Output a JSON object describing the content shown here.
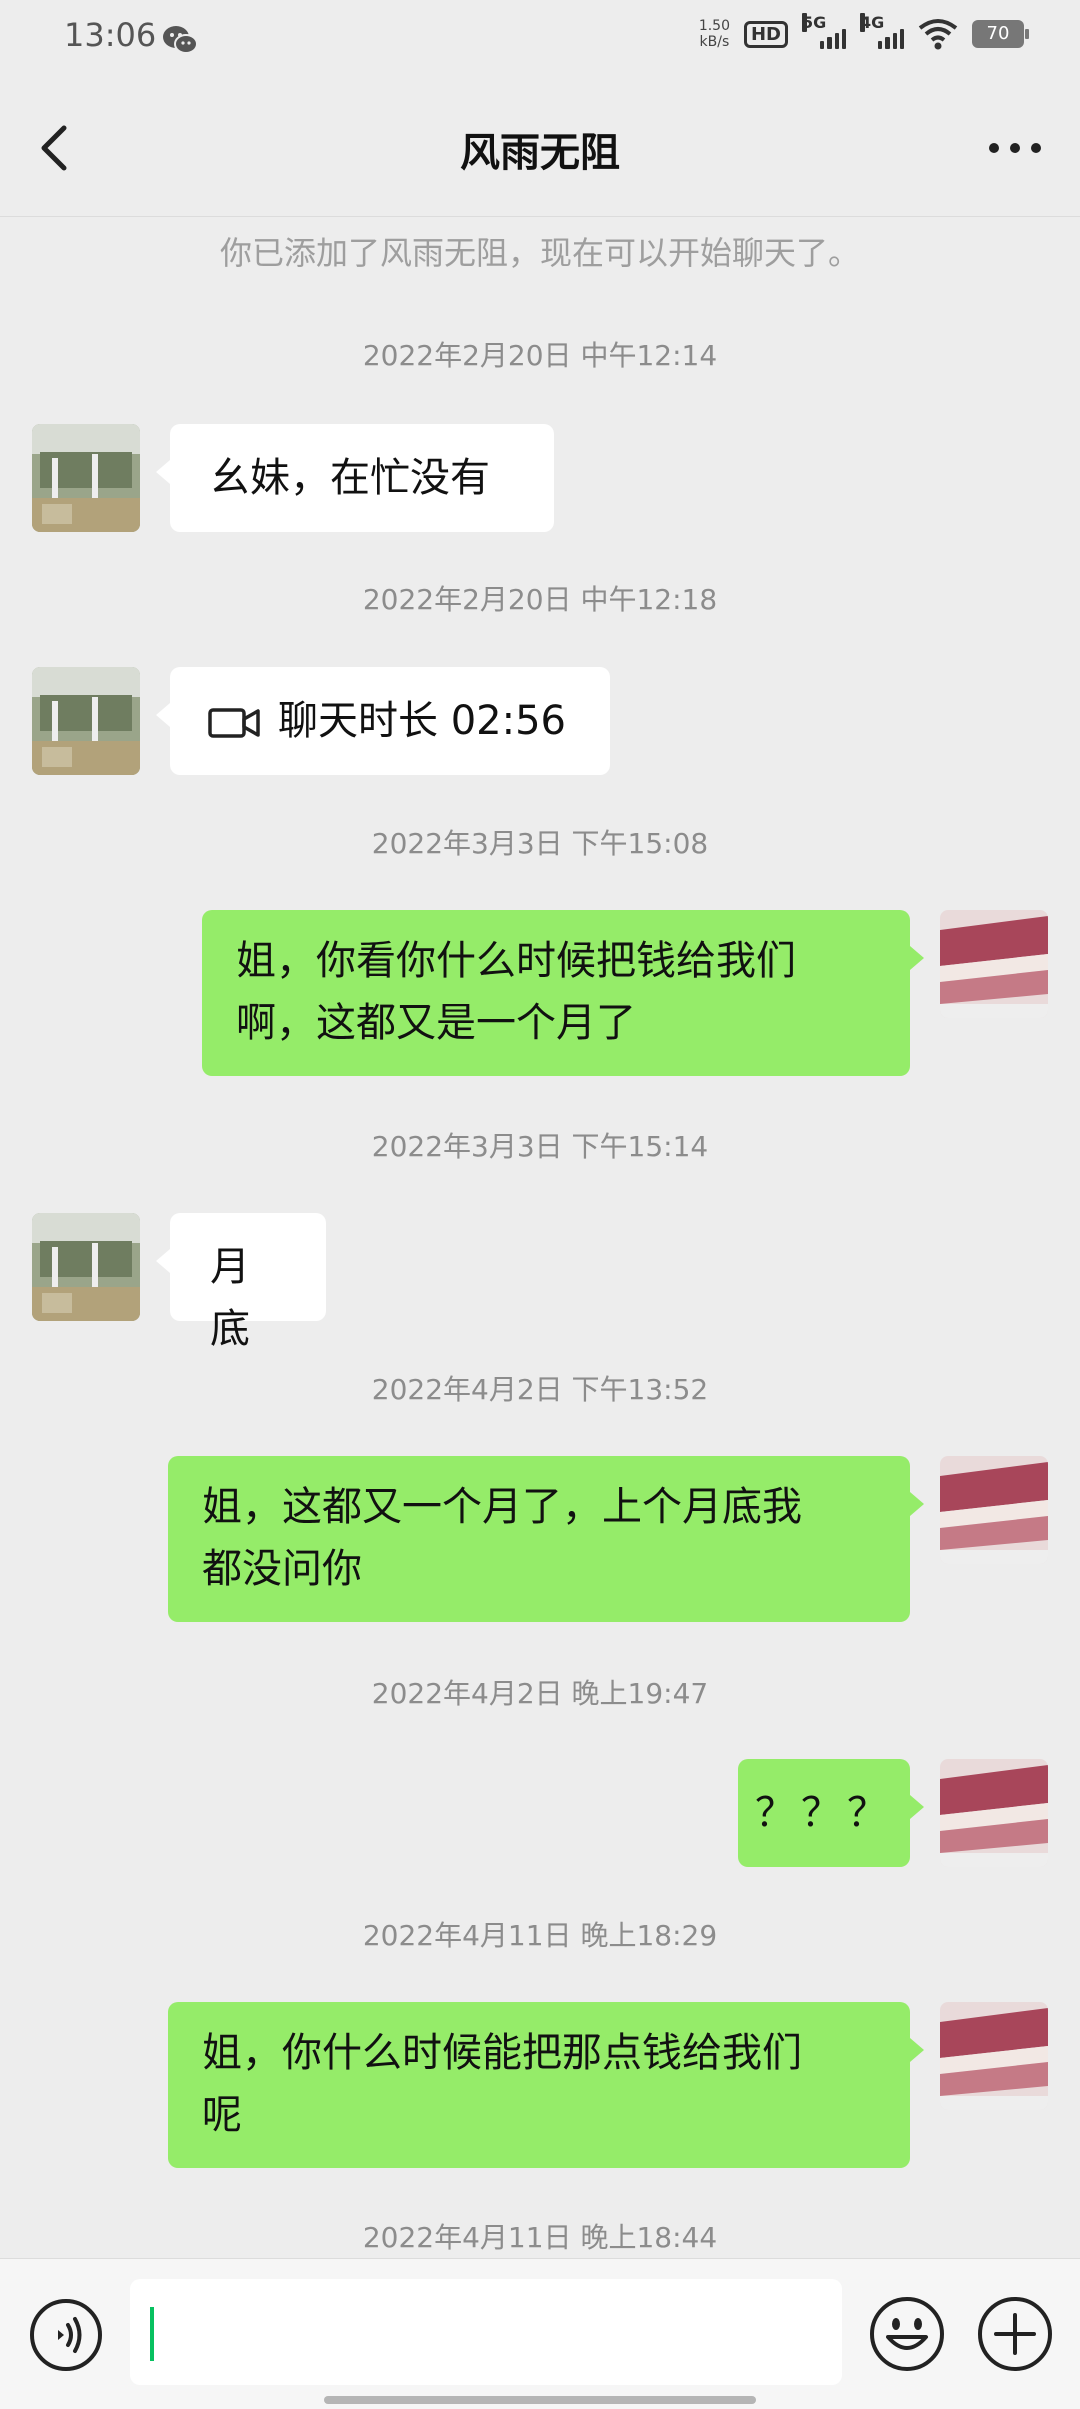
{
  "status_bar": {
    "time": "13:06",
    "net_speed_value": "1.50",
    "net_speed_unit": "kB/s",
    "hd_label": "HD",
    "signal1_label": "5G",
    "signal2_label": "4G",
    "battery": "70",
    "icons": [
      "wechat-icon",
      "hd-icon",
      "signal-5g-icon",
      "signal-4g-icon",
      "wifi-icon",
      "battery-icon"
    ]
  },
  "header": {
    "title": "风雨无阻",
    "back_icon": "chevron-left-icon",
    "more_icon": "more-dots-icon"
  },
  "system_note": "你已添加了风雨无阻，现在可以开始聊天了。",
  "messages": {
    "ts1": "2022年2月20日 中午12:14",
    "m1": "幺妹，在忙没有",
    "ts2": "2022年2月20日 中午12:18",
    "m2": "聊天时长 02:56",
    "ts3": "2022年3月3日 下午15:08",
    "m3_line1": "姐，你看你什么时候把钱给我们",
    "m3_line2": "啊，这都又是一个月了",
    "ts4": "2022年3月3日 下午15:14",
    "m4": "月底",
    "ts5": "2022年4月2日 下午13:52",
    "m5_line1": "姐，这都又一个月了，上个月底我",
    "m5_line2": "都没问你",
    "ts6": "2022年4月2日 晚上19:47",
    "m6": "？？？",
    "ts7": "2022年4月11日 晚上18:29",
    "m7_line1": "姐，你什么时候能把那点钱给我们",
    "m7_line2": "呢",
    "ts8": "2022年4月11日 晚上18:44"
  },
  "input_bar": {
    "value": "",
    "icons": [
      "voice-icon",
      "emoji-icon",
      "plus-icon"
    ]
  },
  "colors": {
    "background": "#ededed",
    "outgoing_bubble": "#95ec69",
    "incoming_bubble": "#ffffff",
    "caret": "#07c160"
  }
}
